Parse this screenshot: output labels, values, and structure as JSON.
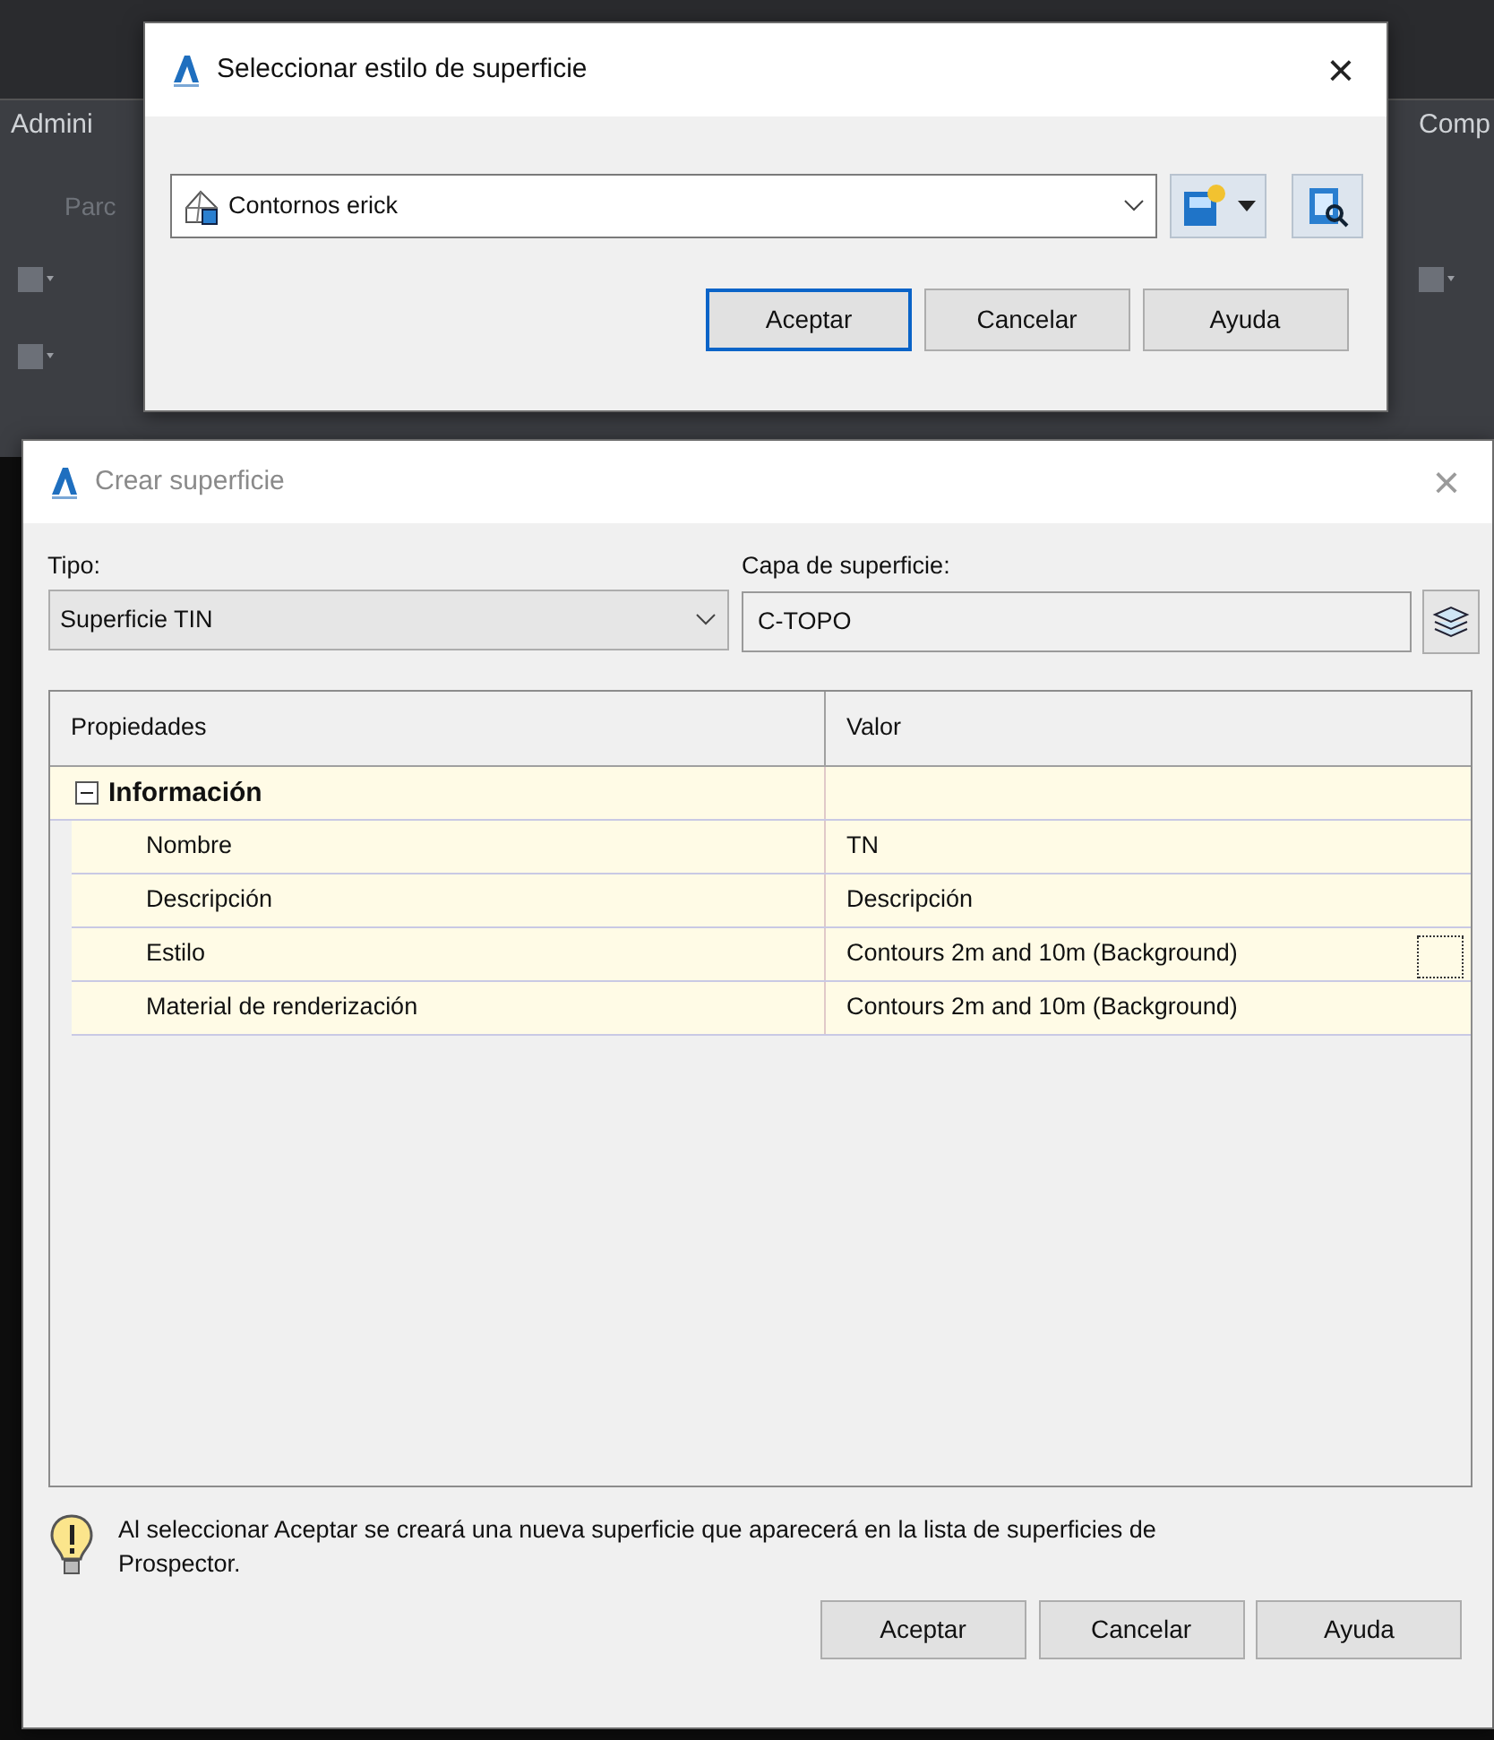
{
  "background": {
    "ribbon_tabs": [
      {
        "label": "Admini"
      },
      {
        "label": "Comp"
      }
    ],
    "ribbon_item": "Parc"
  },
  "style_dialog": {
    "title": "Seleccionar estilo de superficie",
    "active": true,
    "close": "×",
    "style_combo": {
      "value": "Contornos erick"
    },
    "buttons": [
      {
        "label": "Aceptar",
        "default": true
      },
      {
        "label": "Cancelar",
        "default": false
      },
      {
        "label": "Ayuda",
        "default": false
      }
    ]
  },
  "create_dialog": {
    "title": "Crear superficie",
    "active": false,
    "close": "×",
    "type_label": "Tipo:",
    "type_combo": {
      "value": "Superficie TIN"
    },
    "layer_label": "Capa de superficie:",
    "layer_field": {
      "value": "C-TOPO"
    },
    "table": {
      "columns": [
        "Propiedades",
        "Valor"
      ],
      "groups": [
        {
          "label": "Información",
          "expanded": true,
          "children": [
            {
              "name": "Nombre",
              "value": "TN",
              "kind": "text"
            },
            {
              "name": "Descripción",
              "value": "Descripción",
              "kind": "text"
            },
            {
              "name": "Estilo",
              "value": "Contours 2m and 10m (Background)",
              "kind": "picker"
            },
            {
              "name": "Material de renderización",
              "value": "Contours 2m and 10m (Background)",
              "kind": "text"
            }
          ]
        }
      ]
    },
    "message": "Al seleccionar Aceptar se creará una nueva superficie que aparecerá en la lista de superficies de Prospector.",
    "buttons": [
      {
        "label": "Aceptar",
        "default": false
      },
      {
        "label": "Cancelar",
        "default": false
      },
      {
        "label": "Ayuda",
        "default": false
      }
    ]
  }
}
